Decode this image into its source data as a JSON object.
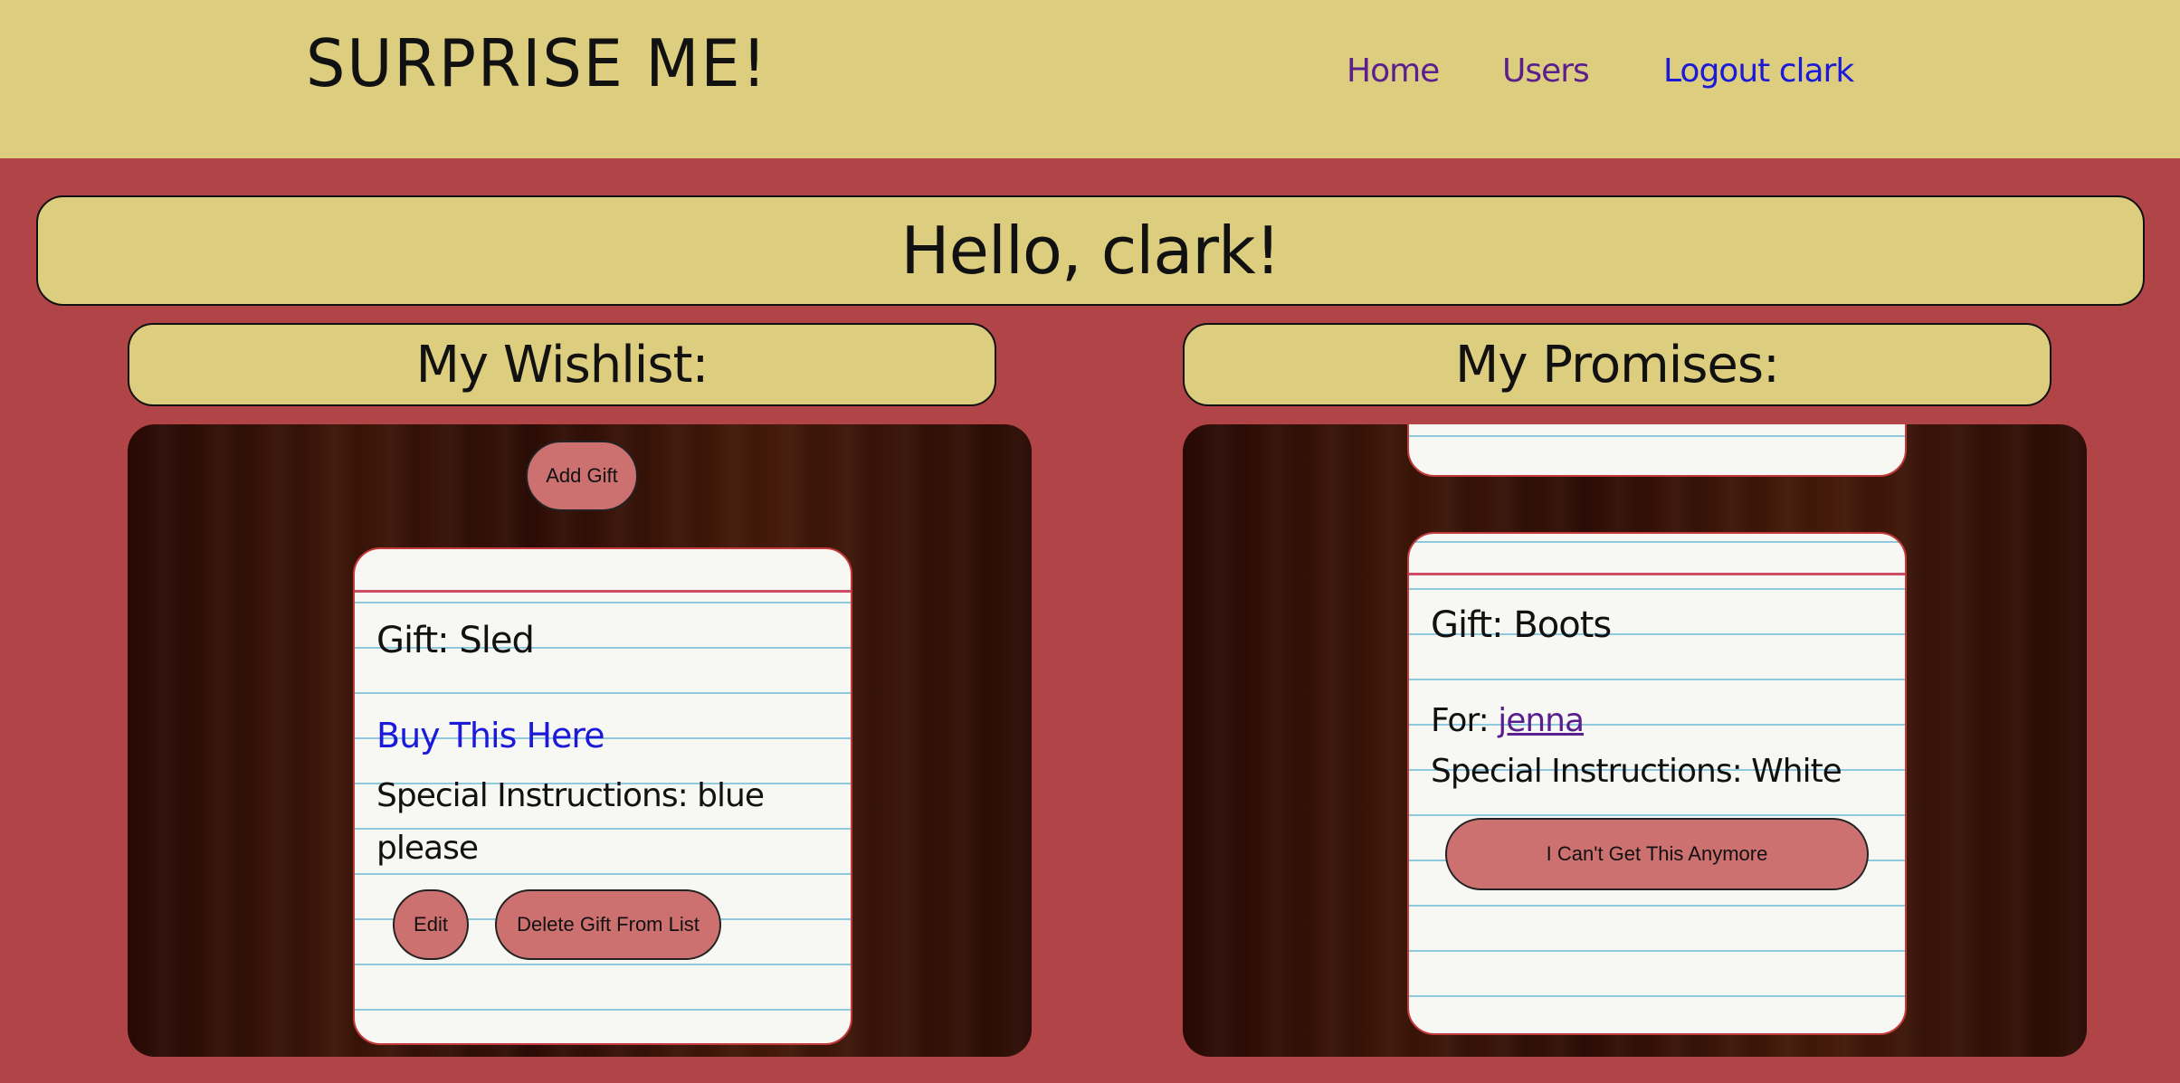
{
  "header": {
    "brand": "SURPRISE ME!",
    "nav": {
      "home": "Home",
      "users": "Users",
      "logout": "Logout clark"
    }
  },
  "greeting": "Hello, clark!",
  "wishlist": {
    "heading": "My Wishlist:",
    "add_gift_label": "Add Gift",
    "card": {
      "title": "Gift: Sled",
      "link_label": "Buy This Here",
      "instructions": "Special Instructions: blue please",
      "edit_label": "Edit",
      "delete_label": "Delete Gift From List"
    }
  },
  "promises": {
    "heading": "My Promises:",
    "card": {
      "title": "Gift: Boots",
      "for_prefix": "For: ",
      "for_name": "jenna",
      "instructions": "Special Instructions: White",
      "cant_label": "I Can't Get This Anymore"
    }
  },
  "colors": {
    "background": "#b04446",
    "header": "#dccd7f",
    "button": "#cc7070",
    "link_visited": "#5a1f8d",
    "link": "#1a1ad8"
  }
}
